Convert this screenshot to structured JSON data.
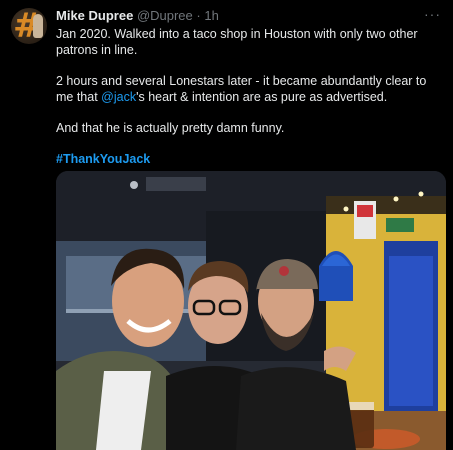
{
  "tweet": {
    "author_name": "Mike Dupree",
    "author_handle": "@Dupree",
    "separator": "·",
    "time": "1h",
    "more_glyph": "···",
    "line1": "Jan 2020.  Walked into a taco shop in Houston with only two other patrons in line.",
    "line2_prefix": "2 hours and several Lonestars later - it became abundantly clear to me that ",
    "mention": "@jack",
    "line2_suffix": "'s heart & intention are as pure as advertised.",
    "line3": "And that he is actually pretty damn funny.",
    "hashtag": "#ThankYouJack"
  },
  "colors": {
    "background": "#000000",
    "text": "#e7e9ea",
    "secondary": "#71767b",
    "link": "#1d9bf0",
    "avatar_hash": "#d98a26"
  },
  "icons": {
    "more": "more-horizontal-icon"
  }
}
